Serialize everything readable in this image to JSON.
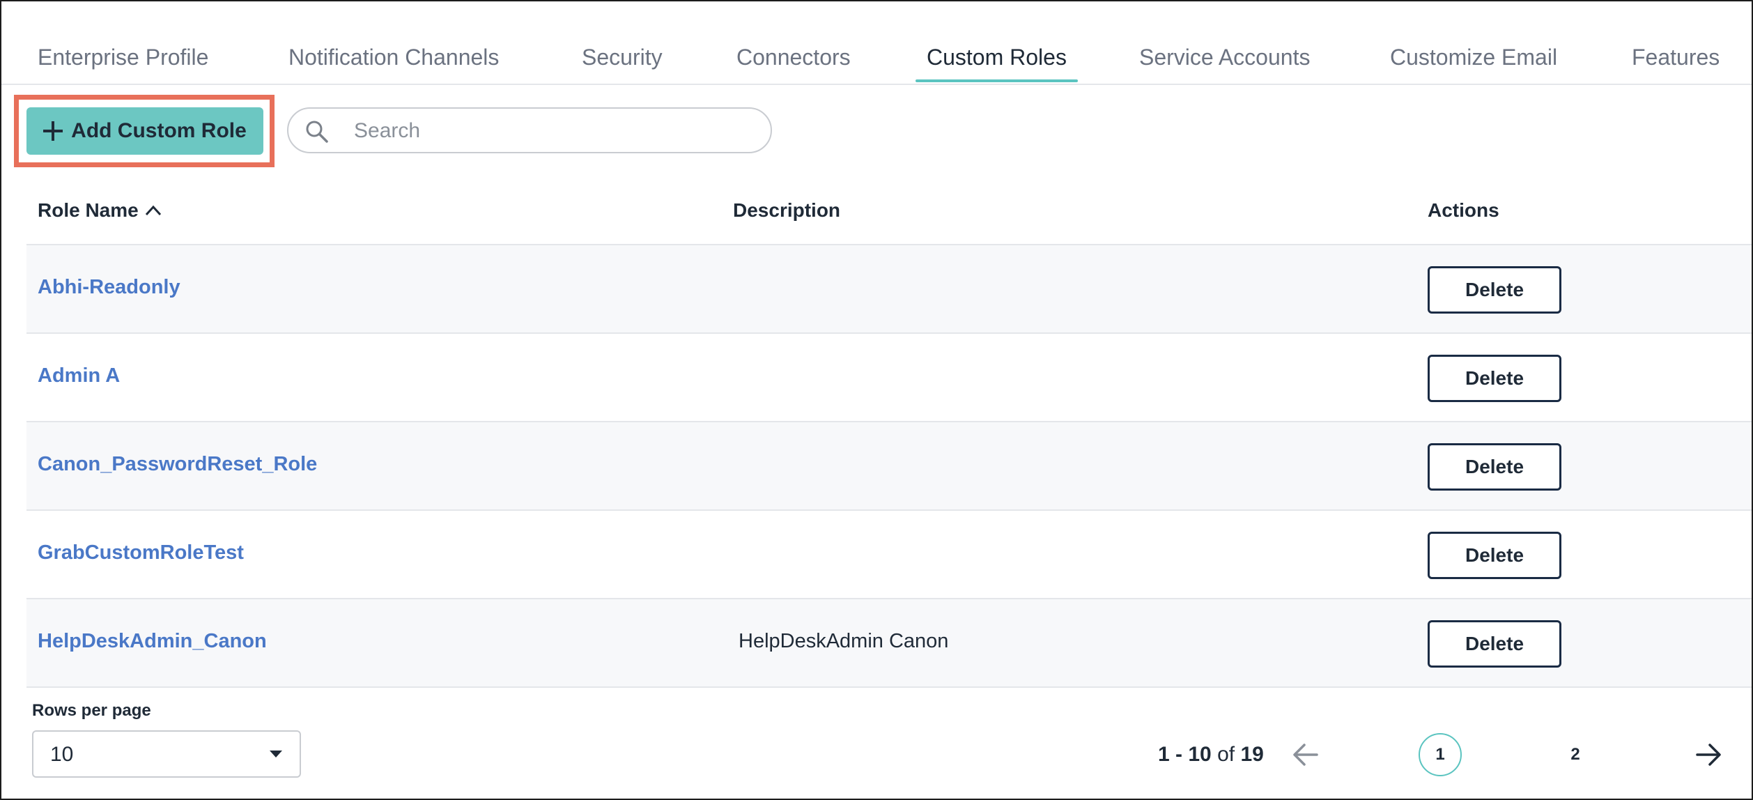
{
  "tabs": [
    {
      "label": "Enterprise Profile",
      "active": false
    },
    {
      "label": "Notification Channels",
      "active": false
    },
    {
      "label": "Security",
      "active": false
    },
    {
      "label": "Connectors",
      "active": false
    },
    {
      "label": "Custom Roles",
      "active": true
    },
    {
      "label": "Service Accounts",
      "active": false
    },
    {
      "label": "Customize Email",
      "active": false
    },
    {
      "label": "Features",
      "active": false
    }
  ],
  "toolbar": {
    "add_label": "Add Custom Role",
    "search_placeholder": "Search",
    "search_value": ""
  },
  "table": {
    "headers": {
      "name": "Role Name",
      "description": "Description",
      "actions": "Actions"
    },
    "sort": {
      "column": "Role Name",
      "direction": "ascending"
    },
    "rows": [
      {
        "name": "Abhi-Readonly",
        "description": "",
        "action": "Delete"
      },
      {
        "name": "Admin A",
        "description": "",
        "action": "Delete"
      },
      {
        "name": "Canon_PasswordReset_Role",
        "description": "",
        "action": "Delete"
      },
      {
        "name": "GrabCustomRoleTest",
        "description": "",
        "action": "Delete"
      },
      {
        "name": "HelpDeskAdmin_Canon",
        "description": "HelpDeskAdmin Canon",
        "action": "Delete"
      }
    ]
  },
  "pagination": {
    "rows_per_page_label": "Rows per page",
    "rows_per_page_value": "10",
    "range_start_end": "1 - 10",
    "range_of": "of",
    "total": "19",
    "pages": [
      "1",
      "2"
    ],
    "current_page": "1"
  },
  "colors": {
    "accent": "#5bc4c0",
    "add_button": "#6cc7c2",
    "link": "#4a78c7",
    "highlight": "#e8705a",
    "delete_border": "#1a2b44"
  },
  "icons": {
    "add": "plus-icon",
    "search": "search-icon",
    "sort": "chevron-up-icon",
    "select": "caret-down-icon",
    "prev": "arrow-left-icon",
    "next": "arrow-right-icon"
  }
}
